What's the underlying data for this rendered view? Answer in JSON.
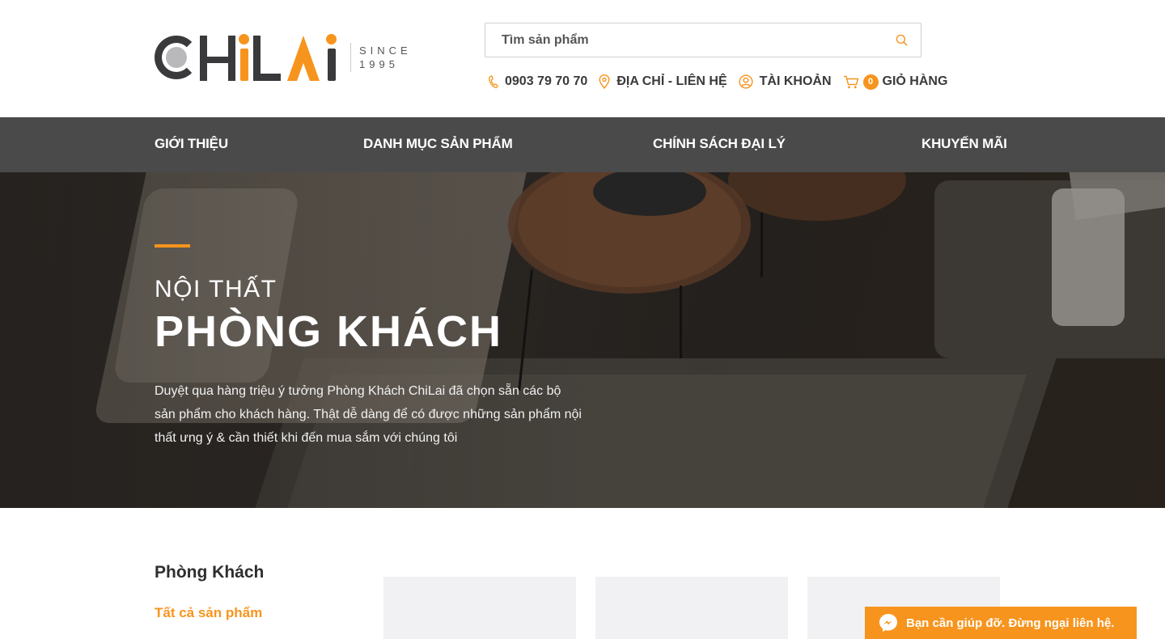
{
  "brand": {
    "name": "CHiLAi",
    "since_label": "SINCE",
    "since_year": "1995",
    "accent_color": "#f7941d",
    "dark_color": "#3a3a3c"
  },
  "search": {
    "placeholder": "Tìm sản phẩm",
    "icon": "search-icon"
  },
  "top_links": {
    "phone": "0903 79 70 70",
    "address": "ĐỊA CHỈ - LIÊN HỆ",
    "account": "TÀI KHOẢN",
    "cart_count": "0",
    "cart": "GIỎ HÀNG"
  },
  "nav": {
    "items": [
      {
        "label": "GIỚI THIỆU"
      },
      {
        "label": "DANH MỤC SẢN PHẨM"
      },
      {
        "label": "CHÍNH SÁCH ĐẠI LÝ"
      },
      {
        "label": "KHUYẾN MÃI"
      }
    ]
  },
  "hero": {
    "subtitle": "NỘI THẤT",
    "title": "PHÒNG KHÁCH",
    "description": "Duyệt qua hàng triệu ý tưởng Phòng Khách ChiLai đã chọn sẵn các bộ sản phẩm cho khách hàng. Thật dễ dàng để có được những sản phẩm nội thất ưng ý & cần thiết khi đến mua sắm với chúng tôi"
  },
  "sidebar": {
    "title": "Phòng Khách",
    "all_products": "Tất cả sản phẩm"
  },
  "chat": {
    "label": "Bạn cần giúp đỡ. Đừng ngại liên hệ."
  }
}
